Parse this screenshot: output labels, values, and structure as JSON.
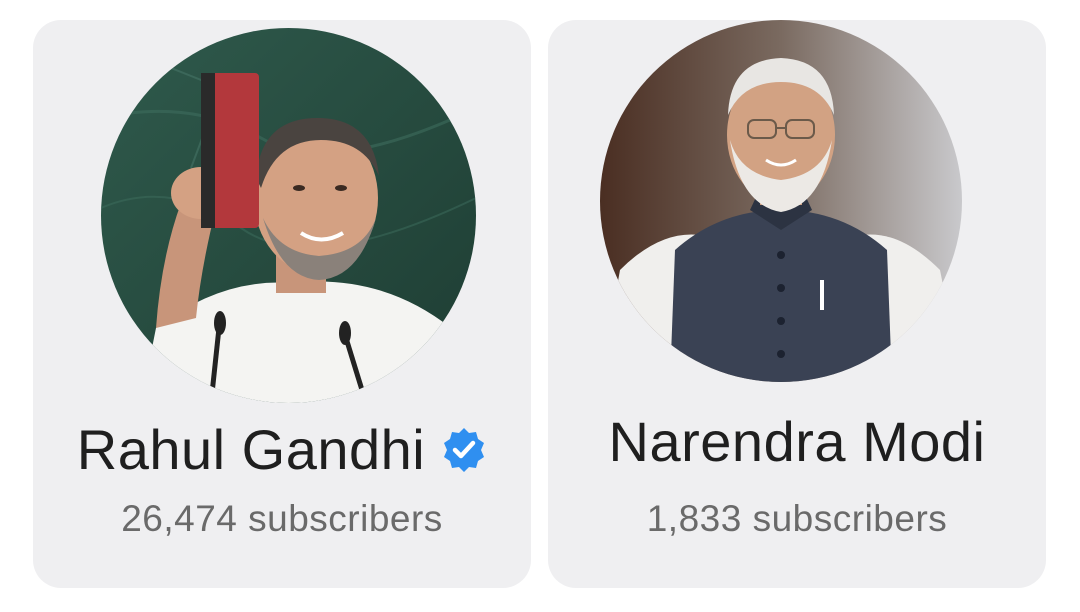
{
  "profiles": [
    {
      "name": "Rahul Gandhi",
      "verified": true,
      "subscribers": "26,474 subscribers",
      "avatar_icon": "profile-photo-rahul-gandhi",
      "accent": "#2f8ff0"
    },
    {
      "name": "Narendra Modi",
      "verified": false,
      "subscribers": "1,833 subscribers",
      "avatar_icon": "profile-photo-narendra-modi"
    }
  ],
  "colors": {
    "card_background": "#efeff1",
    "name_text": "#1f1f1f",
    "subscriber_text": "#6a6a6a",
    "verified_badge": "#2f8ff0"
  }
}
